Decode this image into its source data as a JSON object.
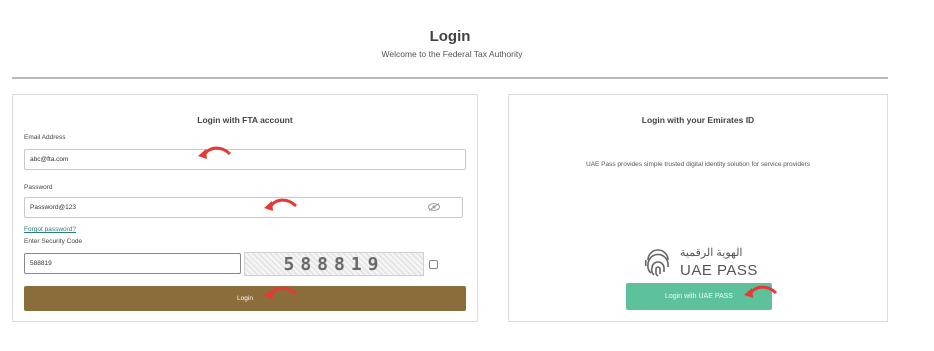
{
  "header": {
    "title": "Login",
    "subtitle": "Welcome to the Federal Tax Authority"
  },
  "fta_panel": {
    "heading": "Login with FTA account",
    "email_label": "Email Address",
    "email_value": "abc@fta.com",
    "password_label": "Password",
    "password_value": "Password@123",
    "forgot_password": "Forgot password?",
    "security_code_label": "Enter Security Code",
    "security_code_value": "588819",
    "captcha_text": "588819",
    "login_button": "Login"
  },
  "uae_panel": {
    "heading": "Login with your Emirates ID",
    "description": "UAE Pass provides simple trusted digital identity solution for service providers",
    "logo_arabic": "الهوية الرقمية",
    "logo_text": "UAE PASS",
    "login_button": "Login with UAE PASS"
  },
  "colors": {
    "login_button": "#8a6d3a",
    "uae_button": "#5dc29b",
    "link": "#2a7f74",
    "annotation_arrow": "#e53935"
  }
}
